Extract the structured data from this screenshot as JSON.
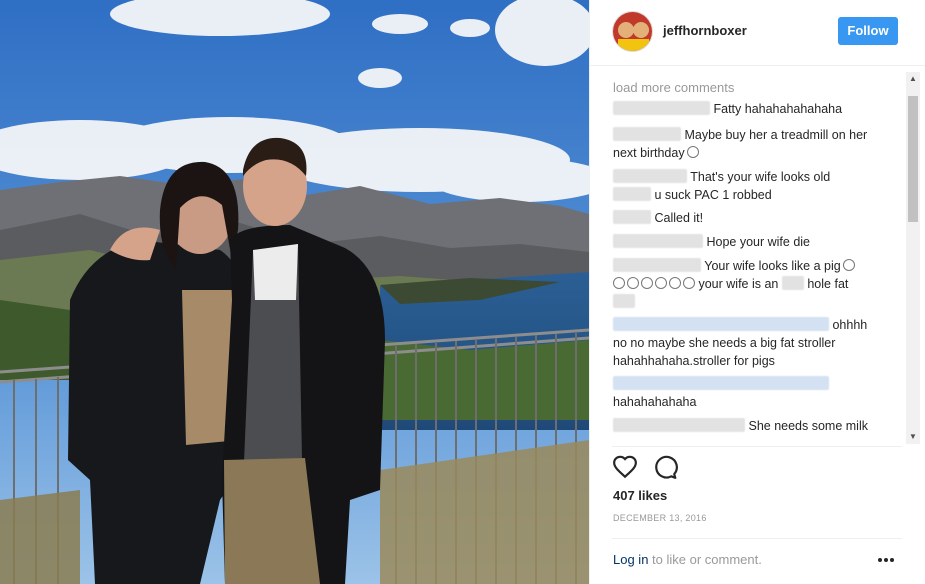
{
  "post": {
    "username": "jeffhornboxer",
    "follow_label": "Follow",
    "load_more": "load more comments",
    "likes": "407 likes",
    "date": "DECEMBER 13, 2016",
    "login_link": "Log in",
    "login_suffix": " to like or comment."
  },
  "comments": [
    {
      "text": "Fatty hahahahahahaha"
    },
    {
      "text": "Maybe buy her a treadmill on her next birthday"
    },
    {
      "text": "That's your wife looks old"
    },
    {
      "text": "u suck PAC 1 robbed"
    },
    {
      "text": "Called it!"
    },
    {
      "text": "Hope your wife die"
    },
    {
      "text": "Your wife looks like a pig"
    },
    {
      "text": "your wife is an"
    },
    {
      "text": "hole fat"
    },
    {
      "text": "ohhhh"
    },
    {
      "text": "no no maybe she needs a big fat stroller"
    },
    {
      "text": "hahahhahaha.stroller for pigs"
    },
    {
      "text": "hahahahahaha"
    },
    {
      "text": "She needs some milk"
    }
  ],
  "icons": [
    "heart-icon",
    "comment-icon",
    "more-icon",
    "scroll-up-icon",
    "scroll-down-icon"
  ],
  "colors": {
    "follow_button": "#3897f0",
    "login_link": "#003569",
    "muted_text": "#999999"
  }
}
